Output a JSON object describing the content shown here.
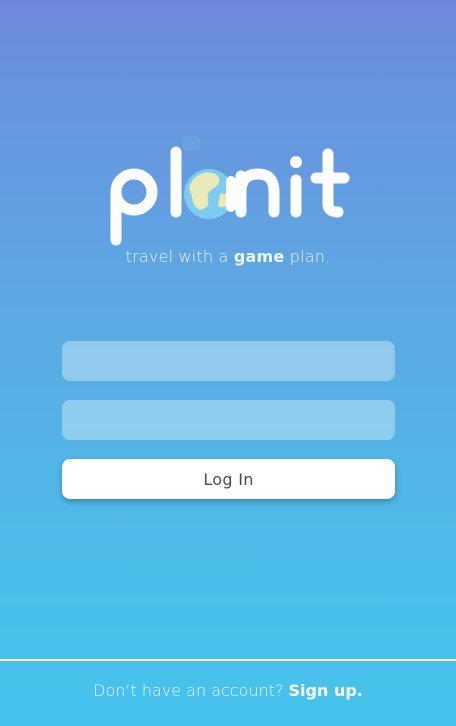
{
  "app": {
    "logo_text": "planit",
    "tagline_prefix": "travel with a",
    "tagline_emphasis": "game",
    "tagline_suffix": "plan."
  },
  "form": {
    "username_value": "",
    "password_value": "",
    "login_label": "Log In"
  },
  "footer": {
    "prompt": "Don’t have an account?",
    "signup_label": "Sign up."
  },
  "colors": {
    "gradient_top": "#6c88dc",
    "gradient_bottom": "#46c3ec",
    "globe": "#7dcbf0",
    "land": "#e9eab5"
  }
}
